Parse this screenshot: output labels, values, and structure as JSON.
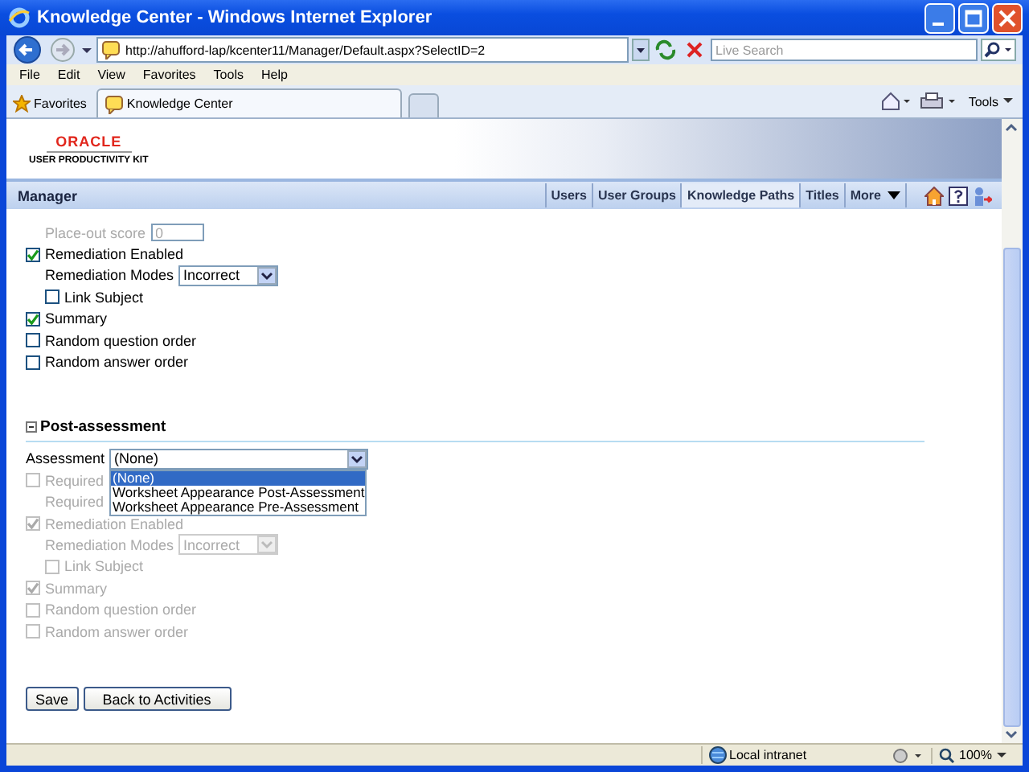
{
  "window": {
    "title": "Knowledge Center - Windows Internet Explorer"
  },
  "address_bar": {
    "url": "http://ahufford-lap/kcenter11/Manager/Default.aspx?SelectID=2",
    "search_placeholder": "Live Search"
  },
  "menu": [
    "File",
    "Edit",
    "View",
    "Favorites",
    "Tools",
    "Help"
  ],
  "favorites_bar": {
    "favorites": "Favorites",
    "tabs": [
      {
        "label": "Knowledge Center",
        "selected": true
      }
    ],
    "tools": "Tools"
  },
  "header": {
    "logo_top": "ORACLE",
    "logo_bottom": "USER PRODUCTIVITY KIT"
  },
  "manager_bar": {
    "title": "Manager",
    "tabs": [
      {
        "label": "Users",
        "selected": false
      },
      {
        "label": "User Groups",
        "selected": false
      },
      {
        "label": "Knowledge Paths",
        "selected": true
      },
      {
        "label": "Titles",
        "selected": false
      },
      {
        "label": "More",
        "selected": false
      }
    ]
  },
  "top_items": [
    {
      "kind": "field",
      "label": "Place-out score",
      "value": "0",
      "disabled": true
    },
    {
      "kind": "check",
      "label": "Remediation Enabled",
      "checked": true,
      "disabled": false,
      "children": [
        {
          "kind": "select",
          "label": "Remediation Modes",
          "value": "Incorrect",
          "disabled": false
        },
        {
          "kind": "check",
          "label": "Link Subject",
          "checked": false,
          "disabled": false
        }
      ]
    },
    {
      "kind": "check",
      "label": "Summary",
      "checked": true,
      "disabled": false
    },
    {
      "kind": "check",
      "label": "Random question order",
      "checked": false,
      "disabled": false
    },
    {
      "kind": "check",
      "label": "Random answer order",
      "checked": false,
      "disabled": false
    }
  ],
  "post_assessment": {
    "title": "Post-assessment",
    "expanded": true,
    "items": [
      {
        "kind": "select",
        "label": "Assessment",
        "value": "(None)",
        "disabled": false,
        "wide": true,
        "options": [
          {
            "label": "(None)",
            "selected": true
          },
          {
            "label": "Worksheet Appearance Post-Assessment",
            "selected": false
          },
          {
            "label": "Worksheet Appearance Pre-Assessment",
            "selected": false
          }
        ]
      },
      {
        "kind": "check",
        "label": "Required",
        "checked": false,
        "disabled": true
      },
      {
        "kind": "text",
        "label": "Required",
        "disabled": true
      },
      {
        "kind": "check",
        "label": "Remediation Enabled",
        "checked": true,
        "disabled": true,
        "children": [
          {
            "kind": "select",
            "label": "Remediation Modes",
            "value": "Incorrect",
            "disabled": true
          },
          {
            "kind": "check",
            "label": "Link Subject",
            "checked": false,
            "disabled": true
          }
        ]
      },
      {
        "kind": "check",
        "label": "Summary",
        "checked": true,
        "disabled": true
      },
      {
        "kind": "check",
        "label": "Random question order",
        "checked": false,
        "disabled": true
      },
      {
        "kind": "check",
        "label": "Random answer order",
        "checked": false,
        "disabled": true
      }
    ]
  },
  "buttons": [
    "Save",
    "Back to Activities"
  ],
  "status_bar": {
    "zone": "Local intranet",
    "zoom": "100%"
  }
}
